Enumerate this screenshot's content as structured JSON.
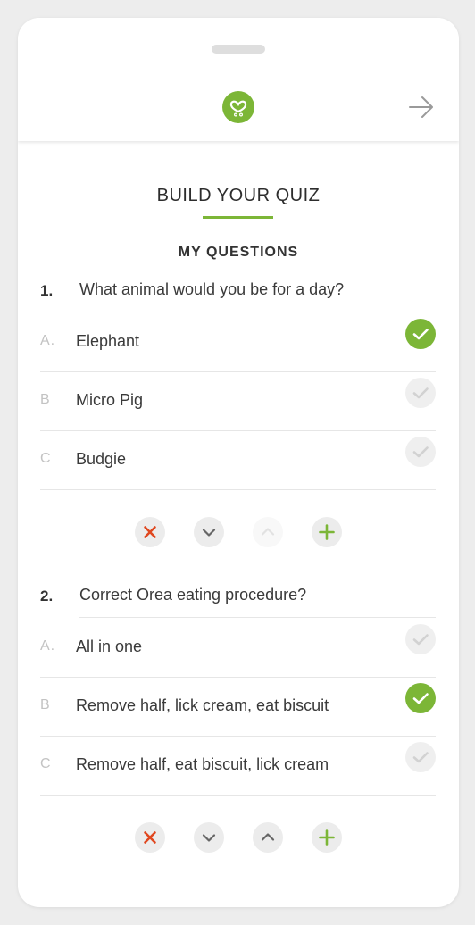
{
  "header": {
    "logo_icon": "heart-chain-icon",
    "next_icon": "arrow-right-icon",
    "brand_color": "#7cb637"
  },
  "page": {
    "title": "BUILD YOUR QUIZ",
    "subtitle": "MY QUESTIONS"
  },
  "questions": [
    {
      "number": "1.",
      "text": "What animal would you be for a day?",
      "answers": [
        {
          "letter": "A.",
          "text": "Elephant",
          "correct": true
        },
        {
          "letter": "B",
          "text": "Micro Pig",
          "correct": false
        },
        {
          "letter": "C",
          "text": "Budgie",
          "correct": false
        }
      ],
      "move_up_enabled": false
    },
    {
      "number": "2.",
      "text": "Correct Orea eating procedure?",
      "answers": [
        {
          "letter": "A.",
          "text": "All in one",
          "correct": false
        },
        {
          "letter": "B",
          "text": "Remove half, lick cream, eat biscuit",
          "correct": true
        },
        {
          "letter": "C",
          "text": "Remove half, eat biscuit, lick cream",
          "correct": false
        }
      ],
      "move_up_enabled": true
    }
  ],
  "action_icons": {
    "delete": "close-icon",
    "move_down": "chevron-down-icon",
    "move_up": "chevron-up-icon",
    "add": "plus-icon",
    "delete_color": "#e0471f",
    "add_color": "#7cb637"
  }
}
